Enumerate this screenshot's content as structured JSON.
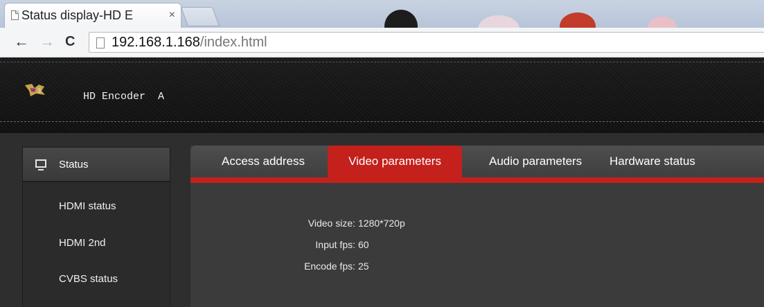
{
  "browser": {
    "tab_title": "Status display-HD E",
    "tab_close": "×",
    "nav": {
      "back": "←",
      "forward": "→",
      "reload": "C"
    },
    "url_host": "192.168.1.168",
    "url_path": "/index.html"
  },
  "header": {
    "device_title": "HD Encoder  A",
    "logo_icon": "brand-logo-icon"
  },
  "sidebar": {
    "section_label": "Status",
    "section_icon": "monitor-icon",
    "items": [
      {
        "label": "HDMI status"
      },
      {
        "label": "HDMI 2nd"
      },
      {
        "label": "CVBS status"
      }
    ]
  },
  "tabs": [
    {
      "label": "Access address"
    },
    {
      "label": "Video parameters",
      "active": true
    },
    {
      "label": "Audio parameters"
    },
    {
      "label": "Hardware status"
    }
  ],
  "video_parameters": [
    {
      "label": "Video size:",
      "value": "1280*720p"
    },
    {
      "label": "Input fps:",
      "value": "60"
    },
    {
      "label": "Encode fps:",
      "value": "25"
    }
  ],
  "colors": {
    "accent": "#c4201c",
    "header_bg": "#141414",
    "panel_bg": "#3b3b3b"
  }
}
